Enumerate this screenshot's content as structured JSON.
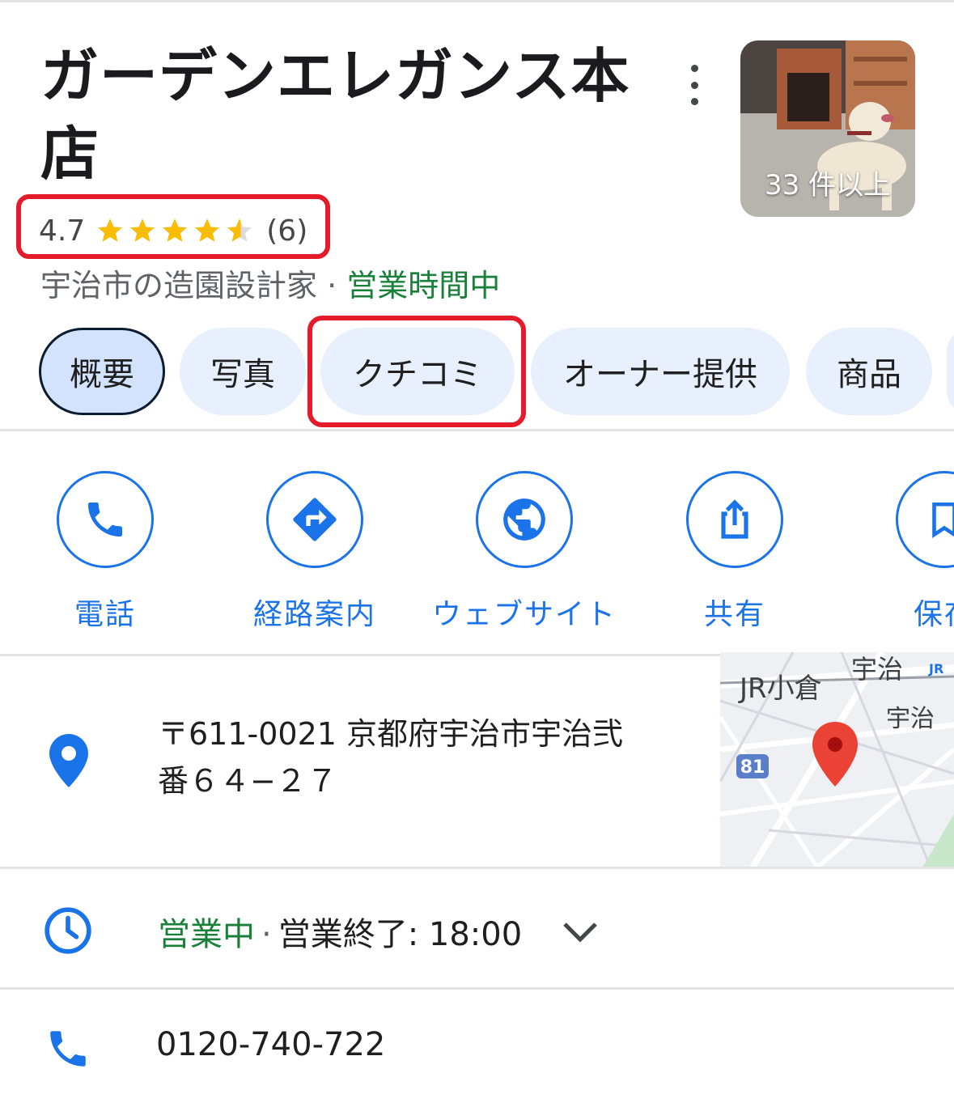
{
  "place": {
    "title": "ガーデンエレガンス本店",
    "photo_count": "33 件以上",
    "rating": "4.7",
    "stars": 4.7,
    "review_count": "(6)",
    "category": "宇治市の造園設計家",
    "separator": "·",
    "open_status": "営業時間中"
  },
  "tabs": [
    {
      "label": "概要"
    },
    {
      "label": "写真"
    },
    {
      "label": "クチコミ"
    },
    {
      "label": "オーナー提供"
    },
    {
      "label": "商品"
    }
  ],
  "actions": [
    {
      "label": "電話",
      "icon": "phone-icon"
    },
    {
      "label": "経路案内",
      "icon": "directions-icon"
    },
    {
      "label": "ウェブサイト",
      "icon": "globe-icon"
    },
    {
      "label": "共有",
      "icon": "share-icon"
    },
    {
      "label": "保存",
      "icon": "bookmark-icon"
    }
  ],
  "info": {
    "address_line1": "〒611-0021 京都府宇治市宇治弐",
    "address_line2": "番６４−２７",
    "hours_status": "営業中",
    "hours_sep": "·",
    "hours_close": "営業終了: 18:00",
    "phone": "0120-740-722"
  },
  "map": {
    "label_uji_top": "宇治",
    "label_jr_ogura": "JR小倉",
    "label_uji": "宇治",
    "label_jr": "JR",
    "route_number": "81"
  },
  "colors": {
    "accent": "#1a73e8",
    "open_green": "#188038",
    "star": "#fbbc04",
    "highlight_red": "#e51a2a",
    "tab_bg": "#e8effd"
  }
}
